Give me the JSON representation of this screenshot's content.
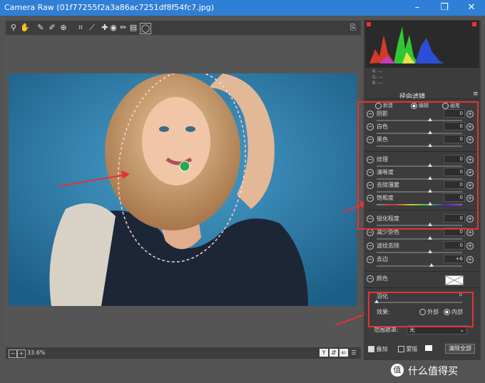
{
  "window": {
    "title": "Camera Raw (01f77255f2a3a86ac7251df8f54fc7.jpg)",
    "controls": [
      "–",
      "❐",
      "✕"
    ],
    "accent": "#2f7fd6"
  },
  "toolbar": {
    "tools": [
      "zoom-tool",
      "hand-tool",
      "white-balance-tool",
      "color-sampler-tool",
      "targeted-adjustment-tool",
      "crop-tool",
      "straighten-tool",
      "spot-removal-tool",
      "red-eye-tool",
      "adjustment-brush-tool",
      "graduated-filter-tool",
      "radial-filter-tool"
    ],
    "open_prefs": "⎘"
  },
  "histogram": {
    "r_label": "R:",
    "g_label": "G:",
    "b_label": "B:",
    "r_value": "—",
    "g_value": "—",
    "b_value": "—"
  },
  "panel": {
    "title": "径向滤镜",
    "modes": {
      "new": "新建",
      "edit": "编辑",
      "brush": "画笔"
    },
    "sliders": [
      {
        "label": "阴影",
        "value": "0",
        "pos": 0.6
      },
      {
        "label": "白色",
        "value": "0",
        "pos": 0.6
      },
      {
        "label": "黑色",
        "value": "0",
        "pos": 0.6
      },
      {
        "label": "纹理",
        "value": "0",
        "pos": 0.6
      },
      {
        "label": "清晰度",
        "value": "0",
        "pos": 0.6
      },
      {
        "label": "去除薄雾",
        "value": "0",
        "pos": 0.6
      },
      {
        "label": "饱和度",
        "value": "0",
        "pos": 0.6
      },
      {
        "label": "锐化程度",
        "value": "0",
        "pos": 0.6
      },
      {
        "label": "减少杂色",
        "value": "0",
        "pos": 0.6
      },
      {
        "label": "波纹去除",
        "value": "0",
        "pos": 0.6
      },
      {
        "label": "去边",
        "value": "+6",
        "pos": 0.62
      }
    ],
    "color_label": "颜色",
    "feather": {
      "label": "羽化",
      "value": "0"
    },
    "effect": {
      "label": "效果:",
      "outside": "外部",
      "inside": "内部"
    },
    "range_mask": {
      "label": "范围遮罩:",
      "value": "无"
    },
    "overlay_label": "叠加",
    "mask_label": "蒙版",
    "clear_all": "清除全部"
  },
  "status": {
    "zoom": "33.6%"
  },
  "watermark": {
    "icon": "值",
    "text": "什么值得买"
  }
}
